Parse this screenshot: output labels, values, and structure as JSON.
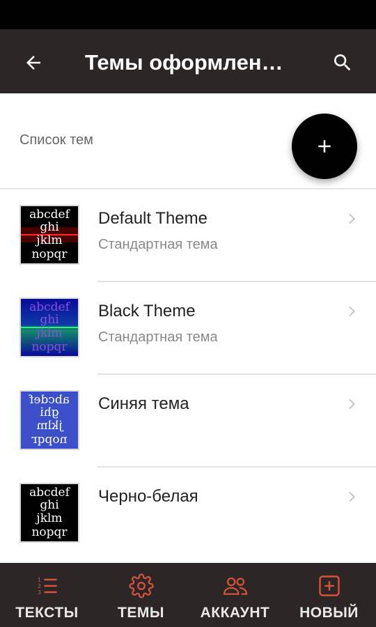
{
  "app_bar": {
    "title": "Темы оформлен…",
    "back_icon": "arrow-back-icon",
    "search_icon": "search-icon"
  },
  "section": {
    "label": "Список тем"
  },
  "fab": {
    "icon": "plus-icon"
  },
  "themes": [
    {
      "title": "Default Theme",
      "subtitle": "Стандартная тема",
      "preview": {
        "lines": [
          "abcdef",
          "ghi",
          "jklm",
          "nopqr"
        ],
        "background": "#000000",
        "accent_line": "#ff2a1a",
        "text": "#ffffff",
        "mirrored": false
      }
    },
    {
      "title": "Black Theme",
      "subtitle": "Стандартная тема",
      "preview": {
        "lines": [
          "abcdef",
          "ghi",
          "jklm",
          "nopqr"
        ],
        "background": "#0a0a9a",
        "accent_line": "#22ff66",
        "text": "#7b4fd8",
        "mirrored": false
      }
    },
    {
      "title": "Синяя тема",
      "subtitle": "",
      "preview": {
        "lines": [
          "abcdef",
          "ghi",
          "jklm",
          "nopqr"
        ],
        "background": "#3a4fc8",
        "accent_line": "",
        "text": "#ffffff",
        "mirrored": true
      }
    },
    {
      "title": "Черно-белая",
      "subtitle": "",
      "preview": {
        "lines": [
          "abcdef",
          "ghi",
          "jklm",
          "nopqr"
        ],
        "background": "#000000",
        "accent_line": "",
        "text": "#ffffff",
        "mirrored": false
      }
    }
  ],
  "bottom_nav": [
    {
      "label": "ТЕКСТЫ",
      "icon": "numbered-list-icon"
    },
    {
      "label": "ТЕМЫ",
      "icon": "gear-icon"
    },
    {
      "label": "АККАУНТ",
      "icon": "people-icon"
    },
    {
      "label": "НОВЫЙ",
      "icon": "add-box-icon"
    }
  ],
  "colors": {
    "app_bar": "#2d2626",
    "nav_icon": "#d9533b",
    "fab": "#000000"
  }
}
